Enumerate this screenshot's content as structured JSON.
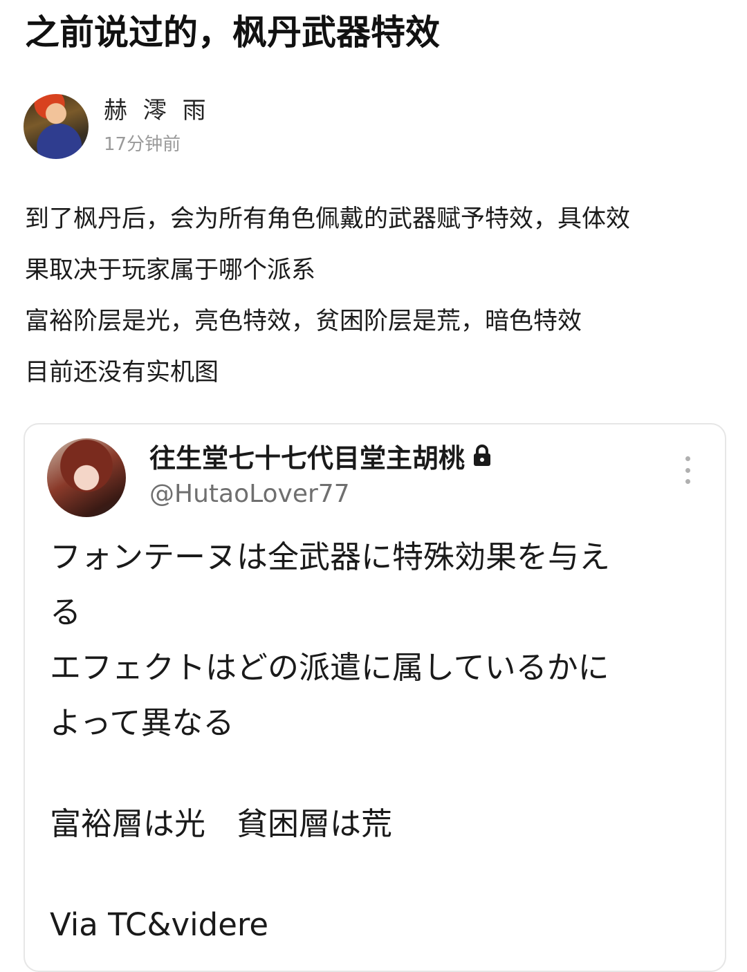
{
  "post": {
    "title": "之前说过的，枫丹武器特效",
    "author": "赫 澪 雨",
    "time": "17分钟前",
    "body": [
      "到了枫丹后，会为所有角色佩戴的武器赋予特效，具体效",
      "果取决于玩家属于哪个派系",
      "富裕阶层是光，亮色特效，贫困阶层是荒，暗色特效",
      "目前还没有实机图"
    ]
  },
  "embed": {
    "name": "往生堂七十七代目堂主胡桃",
    "handle": "@HutaoLover77",
    "lines": [
      "フォンテーヌは全武器に特殊効果を与え",
      "る",
      "エフェクトはどの派遣に属しているかに",
      "よって異なる",
      "富裕層は光　貧困層は荒",
      "Via TC&videre"
    ]
  },
  "icons": {
    "lock": "lock-icon",
    "more": "more-vertical-icon"
  }
}
